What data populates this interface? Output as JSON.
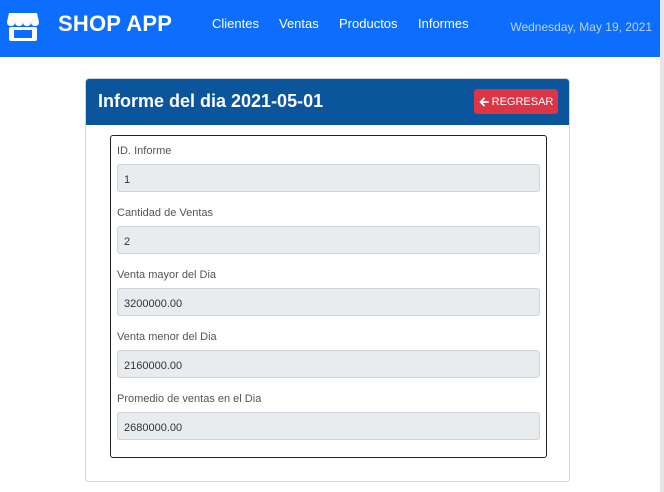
{
  "navbar": {
    "brand": "SHOP APP",
    "brand_icon": "store-icon",
    "links": [
      "Clientes",
      "Ventas",
      "Productos",
      "Informes"
    ],
    "date": "Wednesday, May 19, 2021"
  },
  "report": {
    "title": "Informe del dia 2021-05-01",
    "back_button": {
      "label": "REGRESAR",
      "icon": "arrow-left-icon"
    },
    "fields": [
      {
        "label": "ID. Informe",
        "value": "1"
      },
      {
        "label": "Cantidad de Ventas",
        "value": "2"
      },
      {
        "label": "Venta mayor del Dia",
        "value": "3200000.00"
      },
      {
        "label": "Venta menor del Dia",
        "value": "2160000.00"
      },
      {
        "label": "Promedio de ventas en el Dia",
        "value": "2680000.00"
      }
    ]
  },
  "colors": {
    "navbar": "#0d6efd",
    "card_header": "#0a559c",
    "danger": "#dc3545",
    "input_bg": "#e9ecef"
  }
}
